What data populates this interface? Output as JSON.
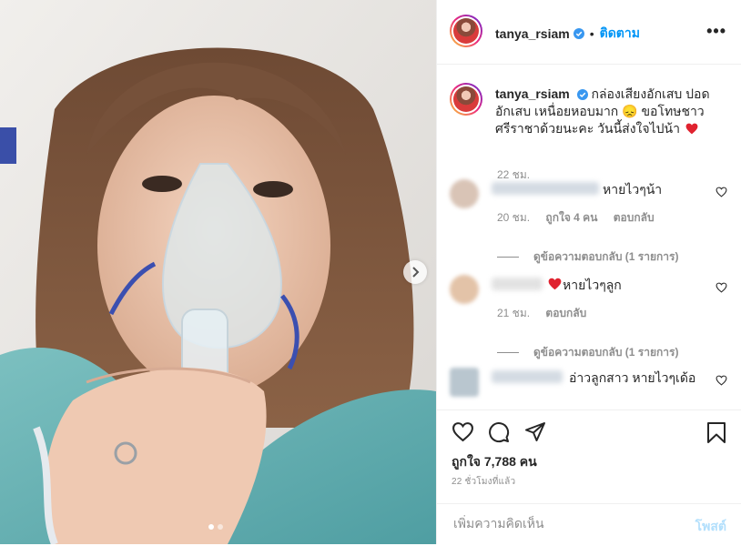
{
  "post": {
    "username": "tanya_rsiam",
    "separator": "•",
    "follow_label": "ติดตาม",
    "more_label": "•••"
  },
  "caption": {
    "username": "tanya_rsiam",
    "text_line1": " กล่องเสียงอักเสบ ปอด",
    "text_line2": "อักเสบ เหนื่อยหอบมาก 😞 ขอโทษชาว",
    "text_line3": "ศรีราชาด้วยนะคะ วันนี้ส่งใจไปน้า",
    "time": "22 ชม."
  },
  "comments": [
    {
      "text": "หายไวๆน้า",
      "time": "20 ชม.",
      "likes": "ถูกใจ 4 คน",
      "reply": "ตอบกลับ",
      "view_replies": "ดูข้อความตอบกลับ (1 รายการ)"
    },
    {
      "text": "หายไวๆลูก",
      "time": "21 ชม.",
      "reply": "ตอบกลับ",
      "view_replies": "ดูข้อความตอบกลับ (1 รายการ)"
    },
    {
      "text": "อ่าวลูกสาว หายไวๆเด้อ"
    }
  ],
  "actions": {
    "likes_count": "ถูกใจ 7,788 คน",
    "time_ago": "22 ชั่วโมงที่แล้ว"
  },
  "add_comment": {
    "placeholder": "เพิ่มความคิดเห็น",
    "post_label": "โพสต์"
  },
  "colors": {
    "accent": "#0095f6",
    "heart_red": "#ed4956",
    "muted": "#8e8e8e",
    "post_disabled": "#b2dffc"
  },
  "carousel": {
    "slide_count": 2,
    "active_index": 0
  }
}
